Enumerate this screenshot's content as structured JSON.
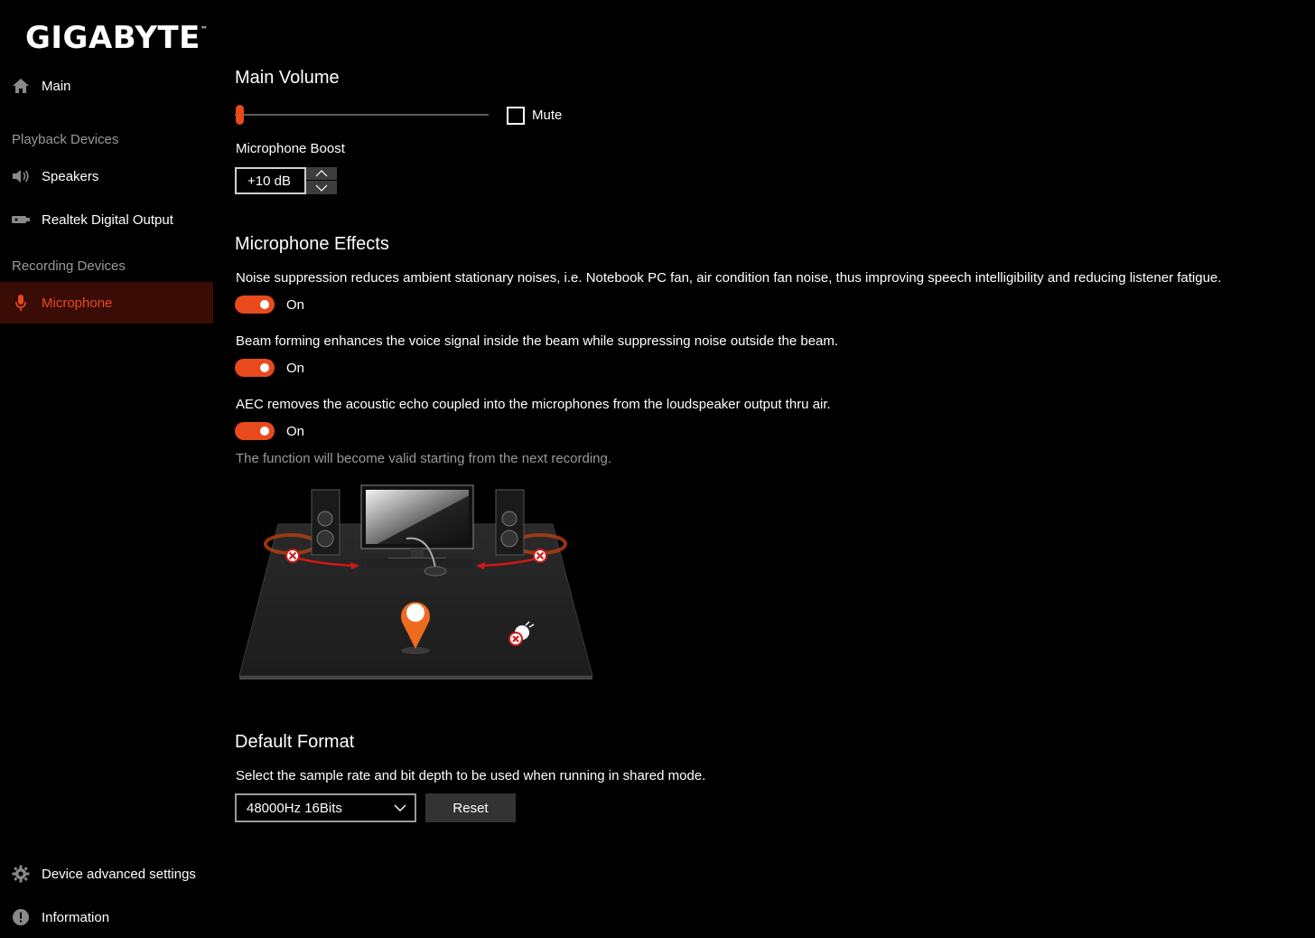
{
  "brand": {
    "logo_text": "GIGABYTE",
    "tm": "™",
    "accent": "#e8491d"
  },
  "sidebar": {
    "main_label": "Main",
    "playback_section": "Playback Devices",
    "speakers_label": "Speakers",
    "digital_output_label": "Realtek Digital Output",
    "recording_section": "Recording Devices",
    "microphone_label": "Microphone",
    "advanced_label": "Device advanced settings",
    "information_label": "Information"
  },
  "volume": {
    "title": "Main Volume",
    "level": 0,
    "mute_label": "Mute",
    "mute_checked": false
  },
  "boost": {
    "label": "Microphone Boost",
    "value": "+10 dB"
  },
  "effects": {
    "title": "Microphone Effects",
    "noise_desc": "Noise suppression reduces ambient stationary noises, i.e. Notebook PC fan, air condition fan noise, thus improving speech intelligibility and reducing listener fatigue.",
    "noise_state": "On",
    "beam_desc": "Beam forming enhances the voice signal inside the beam while suppressing noise outside the beam.",
    "beam_state": "On",
    "aec_desc": "AEC removes the acoustic echo coupled into the microphones from the loudspeaker output thru air.",
    "aec_state": "On",
    "note": "The function will become valid starting from the next recording."
  },
  "format": {
    "title": "Default Format",
    "desc": "Select the sample rate and bit depth to be used when running in shared mode.",
    "selected": "48000Hz 16Bits",
    "reset_label": "Reset"
  }
}
